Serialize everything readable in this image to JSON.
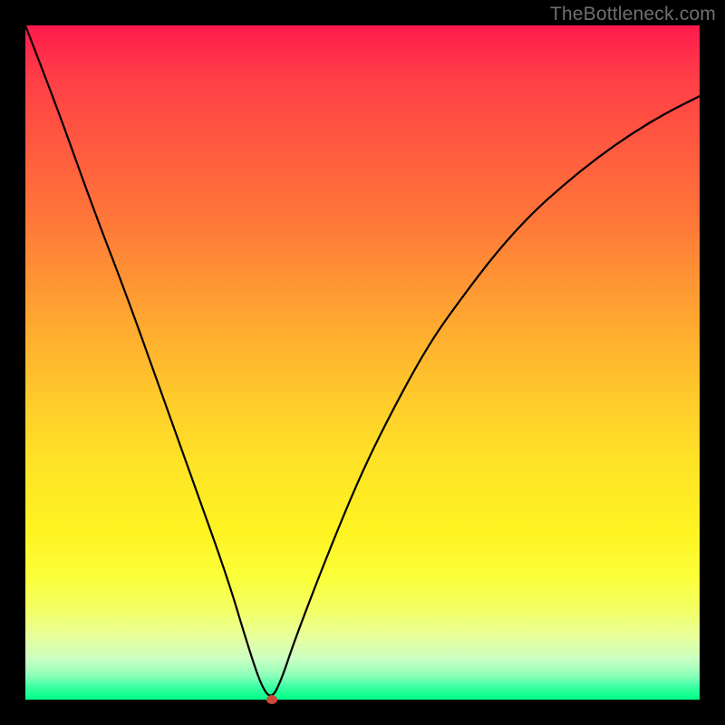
{
  "watermark": "TheBottleneck.com",
  "chart_data": {
    "type": "line",
    "title": "",
    "xlabel": "",
    "ylabel": "",
    "xlim": [
      0,
      100
    ],
    "ylim": [
      0,
      100
    ],
    "grid": false,
    "legend": false,
    "series": [
      {
        "name": "curve",
        "x": [
          0,
          5,
          10,
          15,
          20,
          25,
          30,
          33,
          35,
          36.5,
          38,
          40,
          45,
          50,
          55,
          60,
          65,
          70,
          75,
          80,
          85,
          90,
          95,
          100
        ],
        "y": [
          100,
          87,
          73,
          60,
          46,
          32,
          18,
          8,
          2,
          0,
          3,
          9,
          22,
          34,
          44,
          53,
          60,
          66.5,
          72,
          76.5,
          80.5,
          84,
          87,
          89.5
        ]
      }
    ],
    "marker": {
      "name": "minimum-dot",
      "x": 36.5,
      "y": 0,
      "color": "#cc4a3a"
    },
    "background_gradient": [
      {
        "stop": 0.0,
        "color": "#ff1a4d"
      },
      {
        "stop": 0.5,
        "color": "#ffe326"
      },
      {
        "stop": 1.0,
        "color": "#00ff88"
      }
    ]
  }
}
